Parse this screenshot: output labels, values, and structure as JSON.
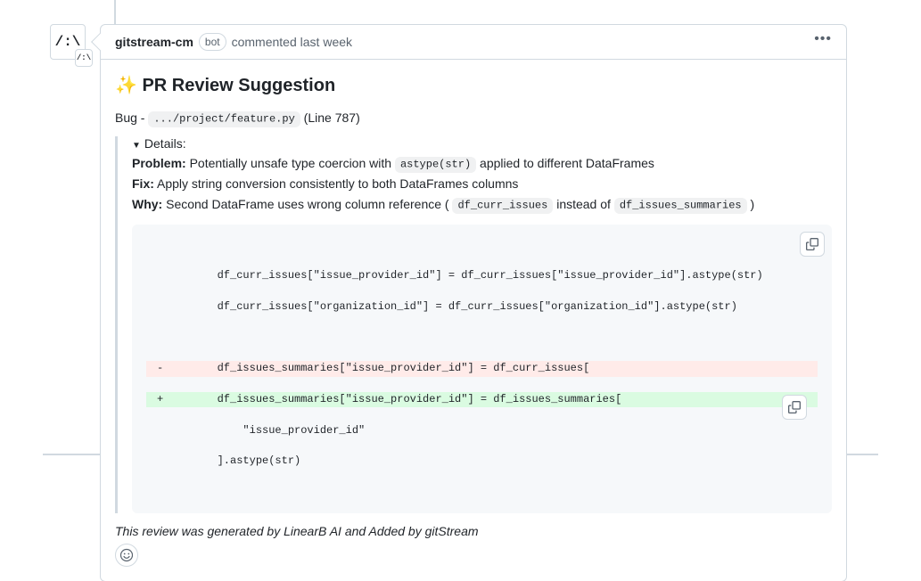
{
  "avatar_text": "/:\\",
  "header": {
    "author": "gitstream-cm",
    "bot_label": "bot",
    "action": "commented",
    "timestamp": "last week"
  },
  "title": "✨ PR Review Suggestion",
  "bug": {
    "label": "Bug - ",
    "path": ".../project/feature.py",
    "line": " (Line 787)"
  },
  "details": {
    "summary": "Details:",
    "problem_label": "Problem:",
    "problem_pre": " Potentially unsafe type coercion with ",
    "problem_code": "astype(str)",
    "problem_post": " applied to different DataFrames",
    "fix_label": "Fix:",
    "fix_text": " Apply string conversion consistently to both DataFrames columns",
    "why_label": "Why:",
    "why_pre": " Second DataFrame uses wrong column reference ( ",
    "why_code1": "df_curr_issues",
    "why_mid": " instead of ",
    "why_code2": "df_issues_summaries",
    "why_post": " )"
  },
  "code": {
    "l1": "        df_curr_issues[\"issue_provider_id\"] = df_curr_issues[\"issue_provider_id\"].astype(str)",
    "l2": "        df_curr_issues[\"organization_id\"] = df_curr_issues[\"organization_id\"].astype(str)",
    "l3": "",
    "del": "        df_issues_summaries[\"issue_provider_id\"] = df_curr_issues[",
    "add": "        df_issues_summaries[\"issue_provider_id\"] = df_issues_summaries[",
    "l6": "            \"issue_provider_id\"",
    "l7": "        ].astype(str)"
  },
  "footer": "This review was generated by LinearB AI and Added by gitStream"
}
